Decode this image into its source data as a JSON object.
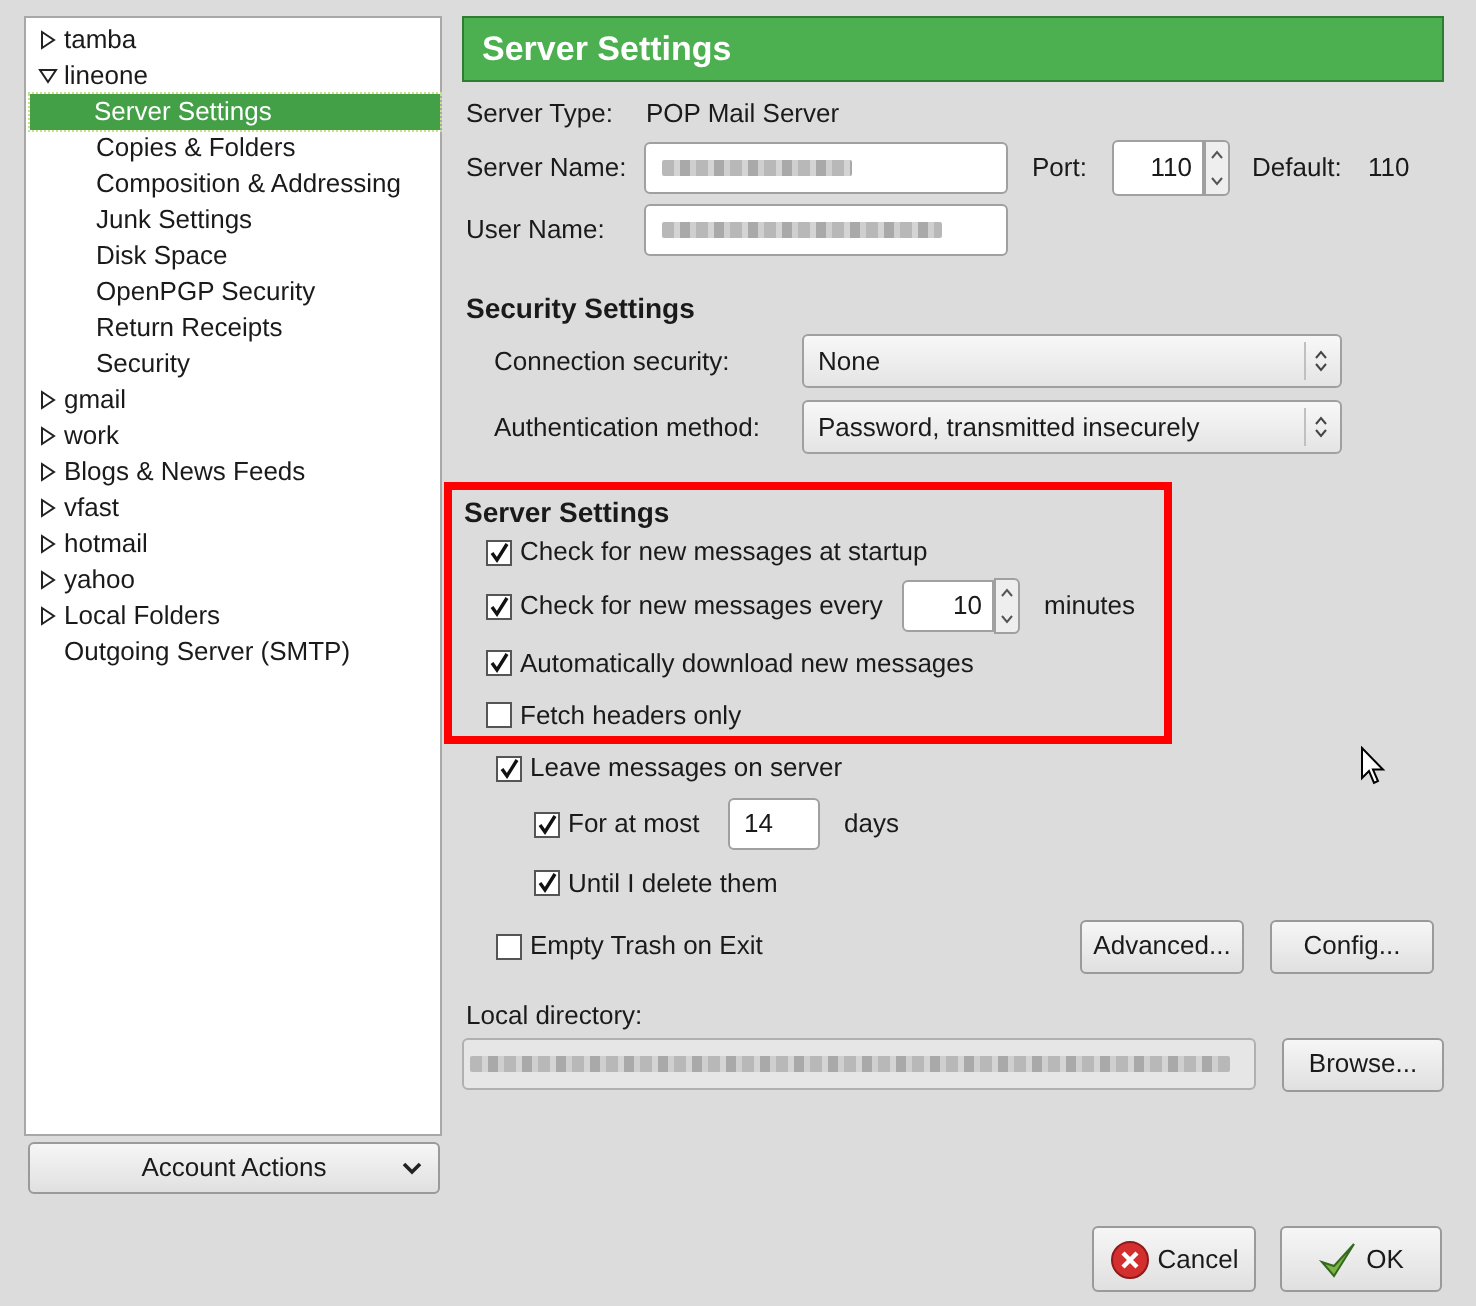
{
  "sidebar": {
    "tree": [
      {
        "label": "tamba",
        "expanded": false,
        "selected": false
      },
      {
        "label": "lineone",
        "expanded": true,
        "selected": false,
        "children": [
          {
            "label": "Server Settings",
            "selected": true
          },
          {
            "label": "Copies & Folders",
            "selected": false
          },
          {
            "label": "Composition & Addressing",
            "selected": false
          },
          {
            "label": "Junk Settings",
            "selected": false
          },
          {
            "label": "Disk Space",
            "selected": false
          },
          {
            "label": "OpenPGP Security",
            "selected": false
          },
          {
            "label": "Return Receipts",
            "selected": false
          },
          {
            "label": "Security",
            "selected": false
          }
        ]
      },
      {
        "label": "gmail",
        "expanded": false,
        "selected": false
      },
      {
        "label": "work",
        "expanded": false,
        "selected": false
      },
      {
        "label": "Blogs & News Feeds",
        "expanded": false,
        "selected": false
      },
      {
        "label": "vfast",
        "expanded": false,
        "selected": false
      },
      {
        "label": "hotmail",
        "expanded": false,
        "selected": false
      },
      {
        "label": "yahoo",
        "expanded": false,
        "selected": false
      },
      {
        "label": "Local Folders",
        "expanded": false,
        "selected": false
      },
      {
        "label": "Outgoing Server (SMTP)",
        "selected": false
      }
    ],
    "account_actions": "Account Actions"
  },
  "header": {
    "title": "Server Settings"
  },
  "server_type": {
    "label": "Server Type:",
    "value": "POP Mail Server"
  },
  "server_name": {
    "label": "Server Name:"
  },
  "port": {
    "label": "Port:",
    "value": "110"
  },
  "default_port": {
    "label": "Default:",
    "value": "110"
  },
  "user_name": {
    "label": "User Name:"
  },
  "security": {
    "title": "Security Settings",
    "fields": [
      {
        "label": "Connection security:",
        "value": "None"
      },
      {
        "label": "Authentication method:",
        "value": "Password, transmitted insecurely"
      }
    ]
  },
  "server_settings": {
    "title": "Server Settings",
    "options": [
      {
        "kind": "checkbox",
        "label": "Check for new messages at startup",
        "checked": true
      },
      {
        "kind": "interval",
        "label": "Check for new messages every",
        "checked": true,
        "value": "10",
        "unit": "minutes"
      },
      {
        "kind": "checkbox",
        "label": "Automatically download new messages",
        "checked": true
      },
      {
        "kind": "checkbox",
        "label": "Fetch headers only",
        "checked": false
      }
    ]
  },
  "leave_messages": {
    "label": "Leave messages on server",
    "checked": true,
    "children": [
      {
        "kind": "days",
        "label": "For at most",
        "checked": true,
        "value": "14",
        "unit": "days"
      },
      {
        "kind": "checkbox",
        "label": "Until I delete them",
        "checked": true
      }
    ]
  },
  "empty_trash": {
    "label": "Empty Trash on Exit",
    "checked": false
  },
  "buttons": [
    "Advanced...",
    "Config..."
  ],
  "local_directory": {
    "label": "Local directory:",
    "button": "Browse..."
  },
  "dialog_buttons": [
    {
      "kind": "cancel",
      "label": "Cancel"
    },
    {
      "kind": "ok",
      "label": "OK"
    }
  ]
}
